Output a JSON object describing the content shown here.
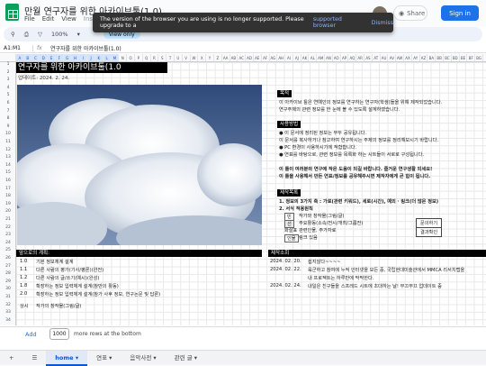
{
  "app": {
    "doc_title": "만월 연구자를 위한 아카이브툴(1.0)",
    "menu": [
      "File",
      "Edit",
      "View",
      "Insert"
    ],
    "share_label": "Share",
    "signin_label": "Sign in"
  },
  "toast": {
    "message": "The version of the browser you are using is no longer supported. Please upgrade to a",
    "link_label": "supported browser",
    "dismiss_label": "Dismiss"
  },
  "toolbar": {
    "zoom": "100%",
    "view_only": "View only"
  },
  "formula_bar": {
    "cell_ref": "A1:M1",
    "content": "연구자를 위한 아카이브툴(1.0)"
  },
  "columns": [
    "A",
    "B",
    "C",
    "D",
    "E",
    "F",
    "G",
    "H",
    "I",
    "J",
    "K",
    "L",
    "M",
    "N",
    "O",
    "P",
    "Q",
    "R",
    "S",
    "T",
    "U",
    "V",
    "W",
    "X",
    "Y",
    "Z",
    "AA",
    "AB",
    "AC",
    "AD",
    "AE",
    "AF",
    "AG",
    "AH",
    "AI",
    "AJ",
    "AK",
    "AL",
    "AM",
    "AN",
    "AO",
    "AP",
    "AQ",
    "AR",
    "AS",
    "AT",
    "AU",
    "AV",
    "AW",
    "AX",
    "AY",
    "AZ",
    "BA",
    "BB",
    "BC",
    "BD",
    "BE",
    "BF",
    "BG"
  ],
  "sheet": {
    "title": "연구자를 위한 아카이브툴(1.0",
    "date": "업데이트: 2024. 2. 24.",
    "intro_header": "목적",
    "intro_lines": [
      "이 아카이브 툴은 연예인의 정보를 연구하는 연구자(학생)들을 위해 제작되었습니다.",
      "연구주제의 관련 정보를 한 눈에 볼 수 있도록 설계하였습니다."
    ],
    "notice_header": "사용방법",
    "notice_lines": [
      "● 이 문서에 정리된 정보는 무두 공유됩니다.",
      "   이 문서를 복사하거나 참고하여 연구하시는 주제의 정보를 정리해보시기 바랍니다.",
      "● PC 환경이 사용하시기에 적합합니다.",
      "● 연표를 바탕으로, 관련 정보를 목록화 하는 시트들이 서로로 구성됩니다."
    ],
    "bold_lines": [
      "이 툴이 여러분의 연구에 작은 도움이 되길 바랍니다. 즐거운 연구생활 되세요!",
      "이 툴을 사용해서 만든 연표/정보를 공유해주시면 제작자에게 큰 힘이 됩니다."
    ],
    "info_header": "제작목록",
    "info_lines": [
      "1. 정보의 3가지 축 : 가로(관련 키워드), 세로(시간), 예외 · 링크(더 많은 정보)",
      "2. 서식 적용원칙"
    ],
    "legend": [
      {
        "tag": "빈",
        "desc": "작가와 창작물(그림/글)"
      },
      {
        "tag": "선",
        "desc": "주요활동(소속/전시/개최/그룹전)"
      },
      {
        "tag": "",
        "desc": "화살표 관련인물, 주가자료"
      },
      {
        "tag": "인물",
        "desc": "링크 있음"
      }
    ],
    "side_buttons": [
      "문의하기",
      "결과확인"
    ],
    "plan_header": "앞으로의 계획:",
    "plan_rows": [
      {
        "num": "1.0",
        "text": "기본 정보체계 설계"
      },
      {
        "num": "1.1",
        "text": "다른 사람의 평가(기사/평론)(완전)"
      },
      {
        "num": "1.2",
        "text": "다른 사람의 글/쓰기(예시)(완성)"
      },
      {
        "num": "1.8",
        "text": "확장하는 정보 입력체계 설계(참만의 활동)"
      },
      {
        "num": "2.0",
        "text": "확장하는 정보 입력체계 설계(참가 사후 정보, 연구논문 및 답론)"
      },
      {
        "num": "상시",
        "text": "작가의 창작물(그림/글)"
      }
    ],
    "log_header": "제작소회",
    "log_rows": [
      {
        "date": "2024. 02. 20.",
        "text": "쉽지않다~~~~"
      },
      {
        "date": "2024. 02. 22.",
        "text": "육군하고 참여에 누적 인터넷을 모든 중, 국립현대미술관에서 MMCA 리서치랩을"
      },
      {
        "date": "",
        "text": "내 프로젝트는 하루만에 막막한다."
      },
      {
        "date": "2024. 02. 24.",
        "text": "내일은 친구들을 스프레드 시트에 초대하는 날! 부끄부끄 업데이트 중"
      }
    ]
  },
  "footer": {
    "add_label": "Add",
    "rows_count": "1000",
    "more_rows_label": "more rows at the bottom",
    "tabs": [
      "home",
      "연표",
      "음악사전",
      "관련 글"
    ],
    "active_tab": "home"
  }
}
